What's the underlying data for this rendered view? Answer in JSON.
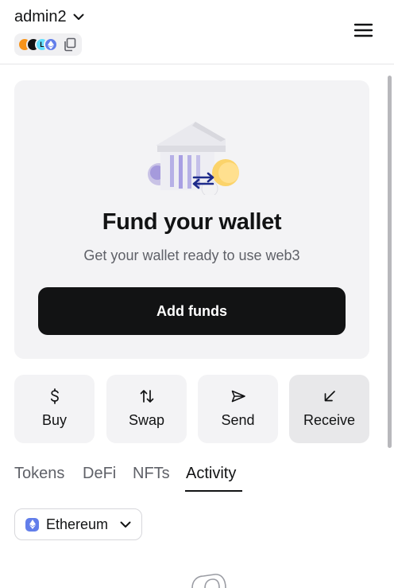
{
  "header": {
    "account_name": "admin2",
    "network_letter": "L"
  },
  "fund_card": {
    "title": "Fund your wallet",
    "subtitle": "Get your wallet ready to use web3",
    "button_label": "Add funds"
  },
  "actions": [
    {
      "label": "Buy",
      "icon": "dollar-icon"
    },
    {
      "label": "Swap",
      "icon": "swap-arrows-icon"
    },
    {
      "label": "Send",
      "icon": "send-arrow-icon"
    },
    {
      "label": "Receive",
      "icon": "receive-arrow-icon"
    }
  ],
  "tabs": [
    {
      "label": "Tokens",
      "active": false
    },
    {
      "label": "DeFi",
      "active": false
    },
    {
      "label": "NFTs",
      "active": false
    },
    {
      "label": "Activity",
      "active": true
    }
  ],
  "network_filter": {
    "selected": "Ethereum"
  },
  "colors": {
    "accent": "#121314",
    "card_bg": "#f3f3f5",
    "ethereum": "#627eea"
  }
}
